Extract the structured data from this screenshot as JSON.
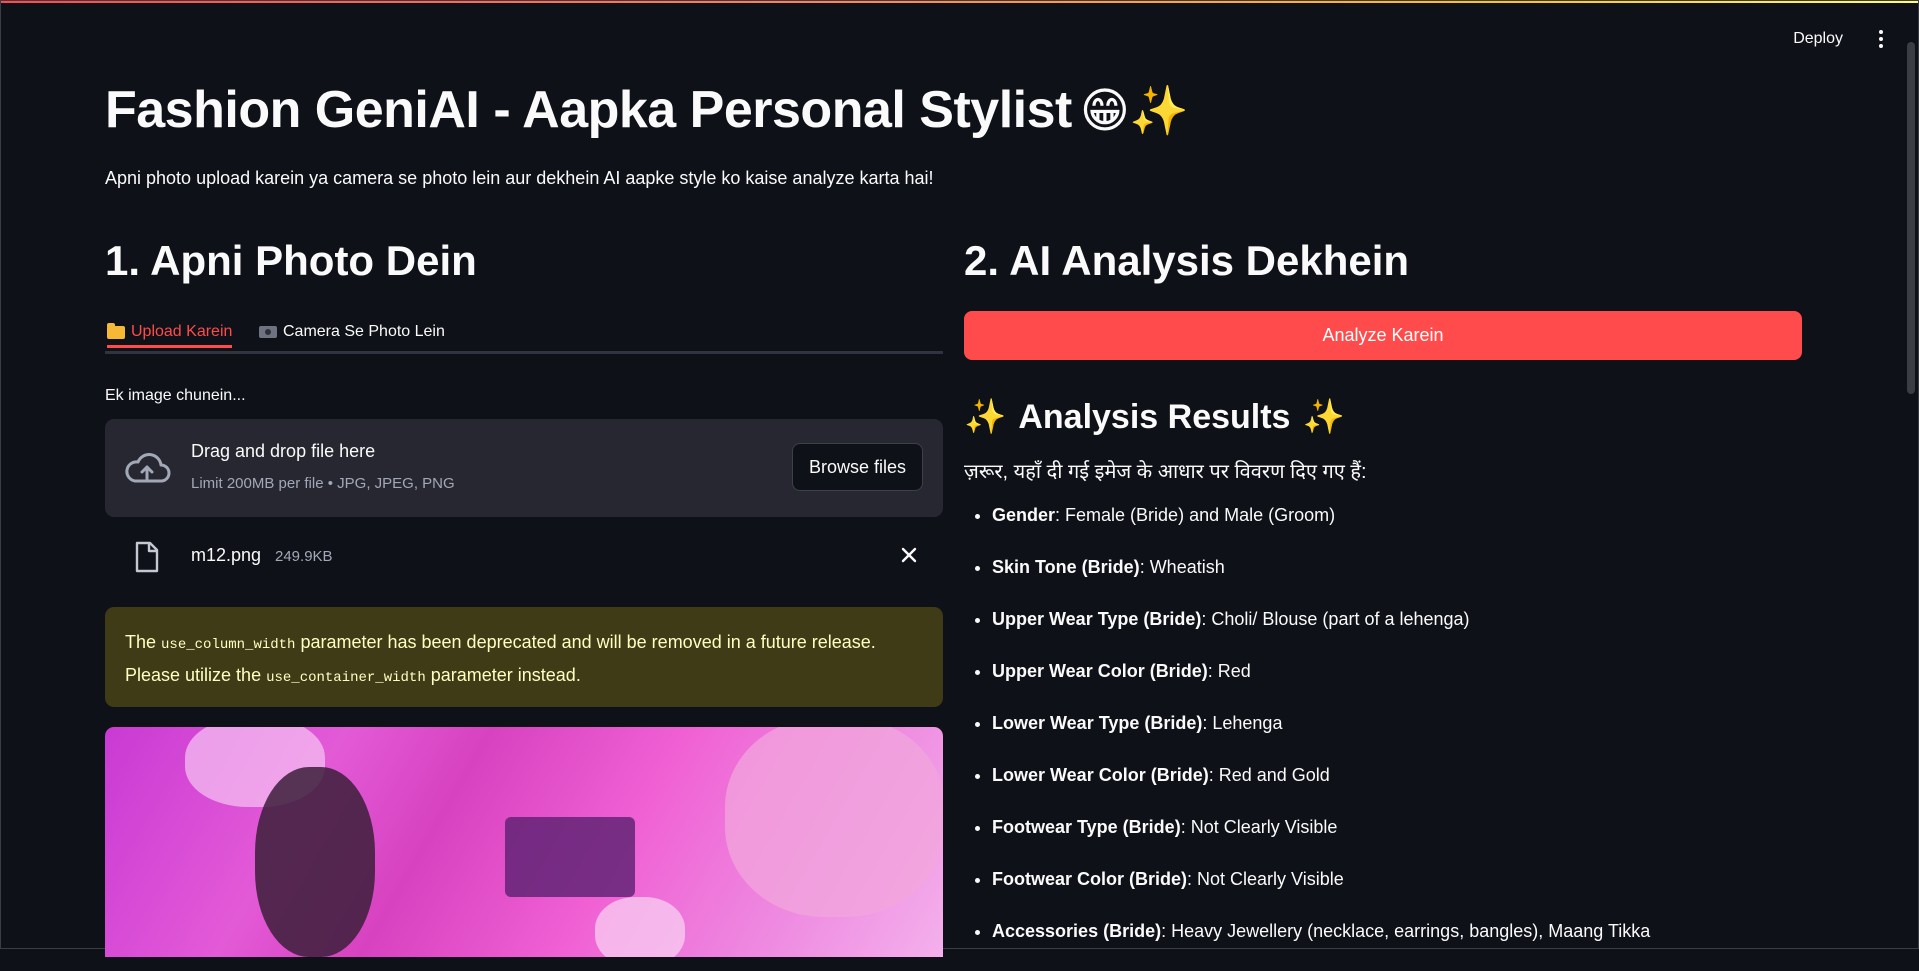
{
  "header": {
    "deploy_label": "Deploy"
  },
  "app": {
    "title": "Fashion GeniAI - Aapka Personal Stylist",
    "title_emoji": "😁✨",
    "subtitle": "Apni photo upload karein ya camera se photo lein aur dekhein AI aapke style ko kaise analyze karta hai!"
  },
  "left": {
    "heading": "1. Apni Photo Dein",
    "tabs": [
      {
        "label": "Upload Karein",
        "icon": "folder-icon",
        "active": true
      },
      {
        "label": "Camera Se Photo Lein",
        "icon": "camera-icon",
        "active": false
      }
    ],
    "uploader": {
      "label": "Ek image chunein...",
      "dropzone_title": "Drag and drop file here",
      "limit_text": "Limit 200MB per file • JPG, JPEG, PNG",
      "browse_label": "Browse files"
    },
    "file": {
      "name": "m12.png",
      "size": "249.9KB"
    },
    "warning": {
      "part1": "The ",
      "code1": "use_column_width",
      "part2": " parameter has been deprecated and will be removed in a future release. Please utilize the ",
      "code2": "use_container_width",
      "part3": " parameter instead."
    }
  },
  "right": {
    "heading": "2. AI Analysis Dekhein",
    "analyze_label": "Analyze Karein",
    "results_title": "Analysis Results",
    "results_sparkle": "✨",
    "intro": "ज़रूर, यहाँ दी गई इमेज के आधार पर विवरण दिए गए हैं:",
    "items": [
      {
        "key": "Gender",
        "value": ": Female (Bride) and Male (Groom)"
      },
      {
        "key": "Skin Tone (Bride)",
        "value": ": Wheatish"
      },
      {
        "key": "Upper Wear Type (Bride)",
        "value": ": Choli/ Blouse (part of a lehenga)"
      },
      {
        "key": "Upper Wear Color (Bride)",
        "value": ": Red"
      },
      {
        "key": "Lower Wear Type (Bride)",
        "value": ": Lehenga"
      },
      {
        "key": "Lower Wear Color (Bride)",
        "value": ": Red and Gold"
      },
      {
        "key": "Footwear Type (Bride)",
        "value": ": Not Clearly Visible"
      },
      {
        "key": "Footwear Color (Bride)",
        "value": ": Not Clearly Visible"
      },
      {
        "key": "Accessories (Bride)",
        "value": ": Heavy Jewellery (necklace, earrings, bangles), Maang Tikka"
      }
    ]
  },
  "colors": {
    "accent": "#ff4b4b",
    "background": "#0e1117",
    "warning_bg": "#3e3b16",
    "warning_text": "#ffffc2"
  }
}
